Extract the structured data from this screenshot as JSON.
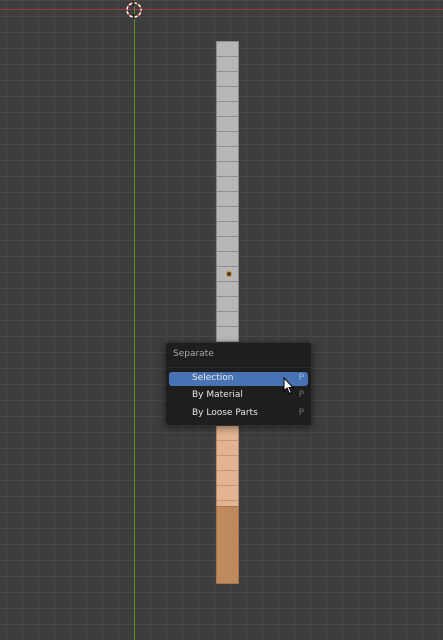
{
  "viewport": {
    "colors": {
      "background": "#3d3d3d",
      "grid": "#484848",
      "x_axis": "#9b3a44",
      "y_axis": "#5c8e24",
      "mesh_unselected": "#b7b7b7",
      "mesh_selected": "#e2b493",
      "menu_highlight": "#4772b3"
    }
  },
  "context_menu": {
    "title": "Separate",
    "items": [
      {
        "label": "Selection",
        "shortcut": "P",
        "active": true
      },
      {
        "label": "By Material",
        "shortcut": "P",
        "active": false
      },
      {
        "label": "By Loose Parts",
        "shortcut": "P",
        "active": false
      }
    ]
  },
  "icons": {
    "cursor": "3d-cursor-icon",
    "origin": "object-origin-icon",
    "pointer": "mouse-pointer-icon"
  }
}
